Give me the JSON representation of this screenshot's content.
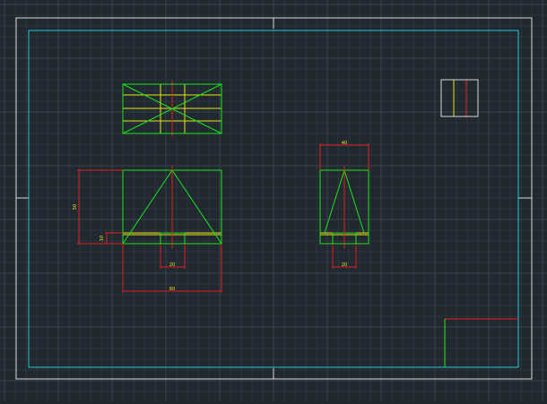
{
  "colors": {
    "background": "#212830",
    "grid_minor": "#2c3440",
    "grid_major": "#39424e",
    "sheet_frame": "#d9d9d9",
    "drawing_border": "#1ec8d6",
    "geometry": "#19e619",
    "centerline": "#e02020",
    "hatch": "#e6e619",
    "dimension": "#e02020",
    "dimension_text": "#e6e619"
  },
  "dimensions": {
    "front_height": "50",
    "front_base_step": "10",
    "front_slot_width": "20",
    "front_total_width": "60",
    "side_top_width": "40",
    "side_slot_width": "20"
  },
  "icons": {
    "layer_swatch": "layer-swatch-icon"
  }
}
